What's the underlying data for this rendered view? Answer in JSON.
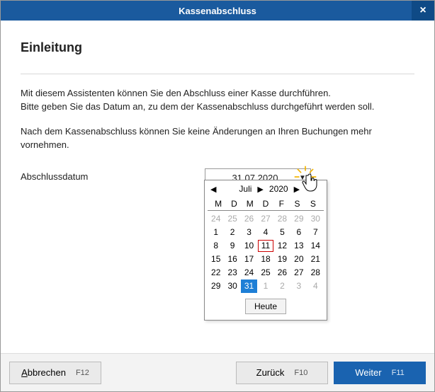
{
  "window": {
    "title": "Kassenabschluss"
  },
  "page": {
    "heading": "Einleitung",
    "para1": "Mit diesem Assistenten können Sie den Abschluss einer Kasse durchführen.",
    "para2": "Bitte geben Sie das Datum an, zu dem der Kassenabschluss durchgeführt werden soll.",
    "para3": "Nach dem Kassenabschluss können Sie keine Änderungen an Ihren Buchungen mehr vornehmen."
  },
  "field": {
    "label": "Abschlussdatum",
    "value": "31.07.2020"
  },
  "calendar": {
    "month": "Juli",
    "year": "2020",
    "dow": [
      "M",
      "D",
      "M",
      "D",
      "F",
      "S",
      "S"
    ],
    "lead_muted": [
      24,
      25,
      26,
      27,
      28,
      29,
      30
    ],
    "rows": [
      [
        1,
        2,
        3,
        4,
        5,
        6,
        7
      ],
      [
        8,
        9,
        10,
        11,
        12,
        13,
        14
      ],
      [
        15,
        16,
        17,
        18,
        19,
        20,
        21
      ],
      [
        22,
        23,
        24,
        25,
        26,
        27,
        28
      ]
    ],
    "last_row_current": [
      29,
      30,
      31
    ],
    "trail_muted": [
      1,
      2,
      3,
      4
    ],
    "today": 11,
    "selected": 31,
    "today_label": "Heute"
  },
  "footer": {
    "cancel": "Abbrechen",
    "cancel_key": "F12",
    "back": "Zurück",
    "back_key": "F10",
    "next": "Weiter",
    "next_key": "F11"
  }
}
